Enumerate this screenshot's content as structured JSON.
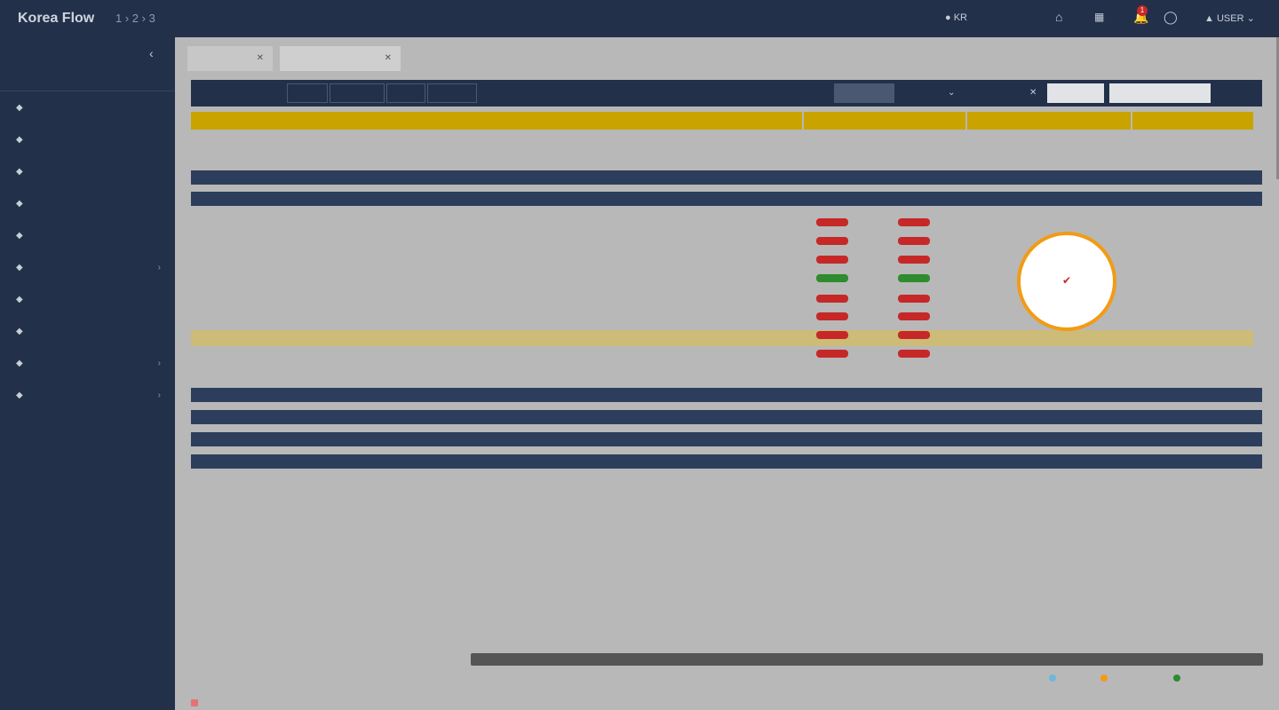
{
  "app": {
    "brand": "Korea Flow",
    "breadcrumb": "1 › 2 › 3"
  },
  "topbar": {
    "lang": "KR",
    "notifications_badge": "1",
    "user": "USER"
  },
  "sidebar": {
    "section_title": "",
    "items": [
      {
        "label": "",
        "icon": "dashboard-icon"
      },
      {
        "label": "",
        "icon": "folder-icon"
      },
      {
        "label": "",
        "icon": "file-icon"
      },
      {
        "label": "",
        "icon": "chart-icon"
      },
      {
        "label": "",
        "icon": "calendar-icon"
      },
      {
        "label": "",
        "icon": "settings-icon",
        "has_children": true
      },
      {
        "label": "",
        "icon": "document-icon"
      },
      {
        "label": "",
        "icon": "edit-icon"
      },
      {
        "label": "",
        "icon": "people-icon",
        "has_children": true
      },
      {
        "label": "",
        "icon": "gear-icon",
        "has_children": true
      }
    ]
  },
  "tabs": [
    {
      "label": "",
      "close": "✕"
    },
    {
      "label": "",
      "close": "✕"
    }
  ],
  "toolbar": {
    "items": [
      "",
      "",
      "",
      "",
      "",
      ""
    ],
    "right_items": [
      "",
      "",
      "",
      ""
    ],
    "search_placeholder": "",
    "search_value": ""
  },
  "table": {
    "group_headers": [
      "",
      "",
      "",
      ""
    ],
    "sub_headers": [
      "",
      "",
      "",
      "",
      "",
      "",
      "",
      "",
      "",
      "",
      ""
    ],
    "row1_cells": [
      "",
      ""
    ],
    "row2_cells": [
      "",
      ""
    ]
  },
  "legend": {
    "title": "",
    "lines": [
      "",
      ""
    ],
    "items": [
      {
        "label": "",
        "color": "#6fb7d8"
      },
      {
        "label": "",
        "color": "#f29b14"
      },
      {
        "label": "",
        "color": "#2e8b2e"
      }
    ]
  },
  "popup": {
    "check": "✔"
  }
}
